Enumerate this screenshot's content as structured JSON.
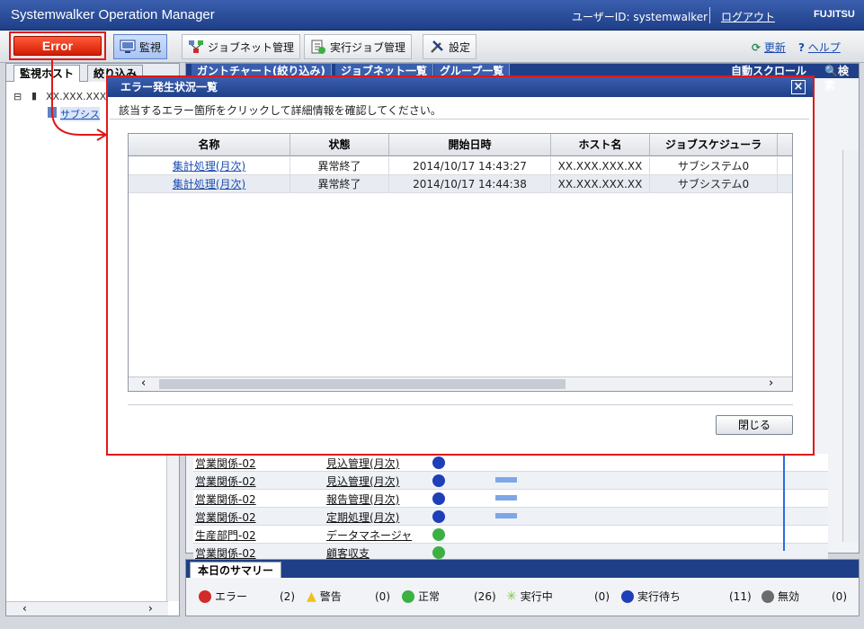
{
  "titlebar": {
    "app_title": "Systemwalker Operation Manager",
    "user_id": "ユーザーID: systemwalker",
    "logout": "ログアウト",
    "brand": "FUJITSU"
  },
  "toolbar": {
    "error_label": "Error",
    "items": [
      {
        "label": "監視"
      },
      {
        "label": "ジョブネット管理"
      },
      {
        "label": "実行ジョブ管理"
      },
      {
        "label": "設定"
      }
    ],
    "refresh": "更新",
    "help": "ヘルプ"
  },
  "left_pane": {
    "tabs": [
      "監視ホスト",
      "絞り込み"
    ],
    "tree": [
      "XX.XXX.XXX.X",
      "サブシス"
    ]
  },
  "right_pane": {
    "tabs": [
      "ガントチャート(絞り込み)",
      "ジョブネット一覧",
      "グループ一覧"
    ],
    "auto_scroll": "自動スクロール",
    "search": "検索",
    "rows": [
      {
        "group": "営業関係-02",
        "name": "見込管理(月次)",
        "status": "running"
      },
      {
        "group": "営業関係-02",
        "name": "見込管理(月次)",
        "status": "waiting"
      },
      {
        "group": "営業関係-02",
        "name": "報告管理(月次)",
        "status": "waiting"
      },
      {
        "group": "営業関係-02",
        "name": "定期処理(月次)",
        "status": "waiting"
      },
      {
        "group": "生産部門-02",
        "name": "データマネージャ",
        "status": "ok"
      },
      {
        "group": "営業関係-02",
        "name": "顧客収支",
        "status": "ok"
      }
    ]
  },
  "summary": {
    "tab": "本日のサマリー",
    "items": [
      {
        "label": "エラー",
        "count": "(2)",
        "color": "#d32a2a"
      },
      {
        "label": "警告",
        "count": "(0)",
        "color": "#f0c020"
      },
      {
        "label": "正常",
        "count": "(26)",
        "color": "#3cb043"
      },
      {
        "label": "実行中",
        "count": "(0)",
        "color": "#7ac943"
      },
      {
        "label": "実行待ち",
        "count": "(11)",
        "color": "#1f3fb8"
      },
      {
        "label": "無効",
        "count": "(0)",
        "color": "#6b6b6b"
      }
    ]
  },
  "dialog": {
    "title": "エラー発生状況一覧",
    "close_glyph": "×",
    "description": "該当するエラー箇所をクリックして詳細情報を確認してください。",
    "columns": [
      "名称",
      "状態",
      "開始日時",
      "ホスト名",
      "ジョブスケジューラ"
    ],
    "rows": [
      {
        "name": "集計処理(月次)",
        "status": "異常終了",
        "start": "2014/10/17 14:43:27",
        "host": "XX.XXX.XXX.XX",
        "scheduler": "サブシステム0"
      },
      {
        "name": "集計処理(月次)",
        "status": "異常終了",
        "start": "2014/10/17 14:44:38",
        "host": "XX.XXX.XXX.XX",
        "scheduler": "サブシステム0"
      }
    ],
    "close_label": "閉じる"
  },
  "colors": {
    "accent": "#1f3f88",
    "error_red": "#e01818"
  }
}
